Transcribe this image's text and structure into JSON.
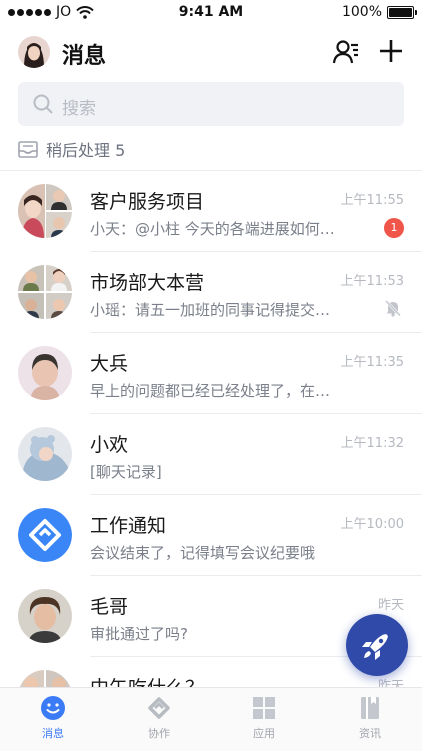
{
  "status_bar": {
    "carrier": "JO",
    "time": "9:41 AM",
    "battery": "100%"
  },
  "header": {
    "title": "消息"
  },
  "search": {
    "placeholder": "搜索"
  },
  "later": {
    "label": "稍后处理 5"
  },
  "conversations": [
    {
      "name": "客户服务项目",
      "message": "小天：@小柱 今天的各端进展如何…",
      "time": "上午11:55",
      "badge": "1"
    },
    {
      "name": "市场部大本营",
      "message": "小瑶：请五一加班的同事记得提交…",
      "time": "上午11:53",
      "muted": true
    },
    {
      "name": "大兵",
      "message": "早上的问题都已经已经处理了，在…",
      "time": "上午11:35"
    },
    {
      "name": "小欢",
      "message": "[聊天记录]",
      "time": "上午11:32"
    },
    {
      "name": "工作通知",
      "message": "会议结束了，记得填写会议纪要哦",
      "time": "上午10:00"
    },
    {
      "name": "毛哥",
      "message": "审批通过了吗?",
      "time": "昨天"
    },
    {
      "name": "中午吃什么？",
      "message": "",
      "time": "昨天"
    }
  ],
  "tabbar": {
    "tabs": [
      {
        "label": "消息",
        "active": true
      },
      {
        "label": "协作"
      },
      {
        "label": "应用"
      },
      {
        "label": "资讯"
      }
    ]
  },
  "colors": {
    "accent": "#3b7bf6",
    "fab": "#2f4aa8",
    "badge": "#f0554a"
  }
}
